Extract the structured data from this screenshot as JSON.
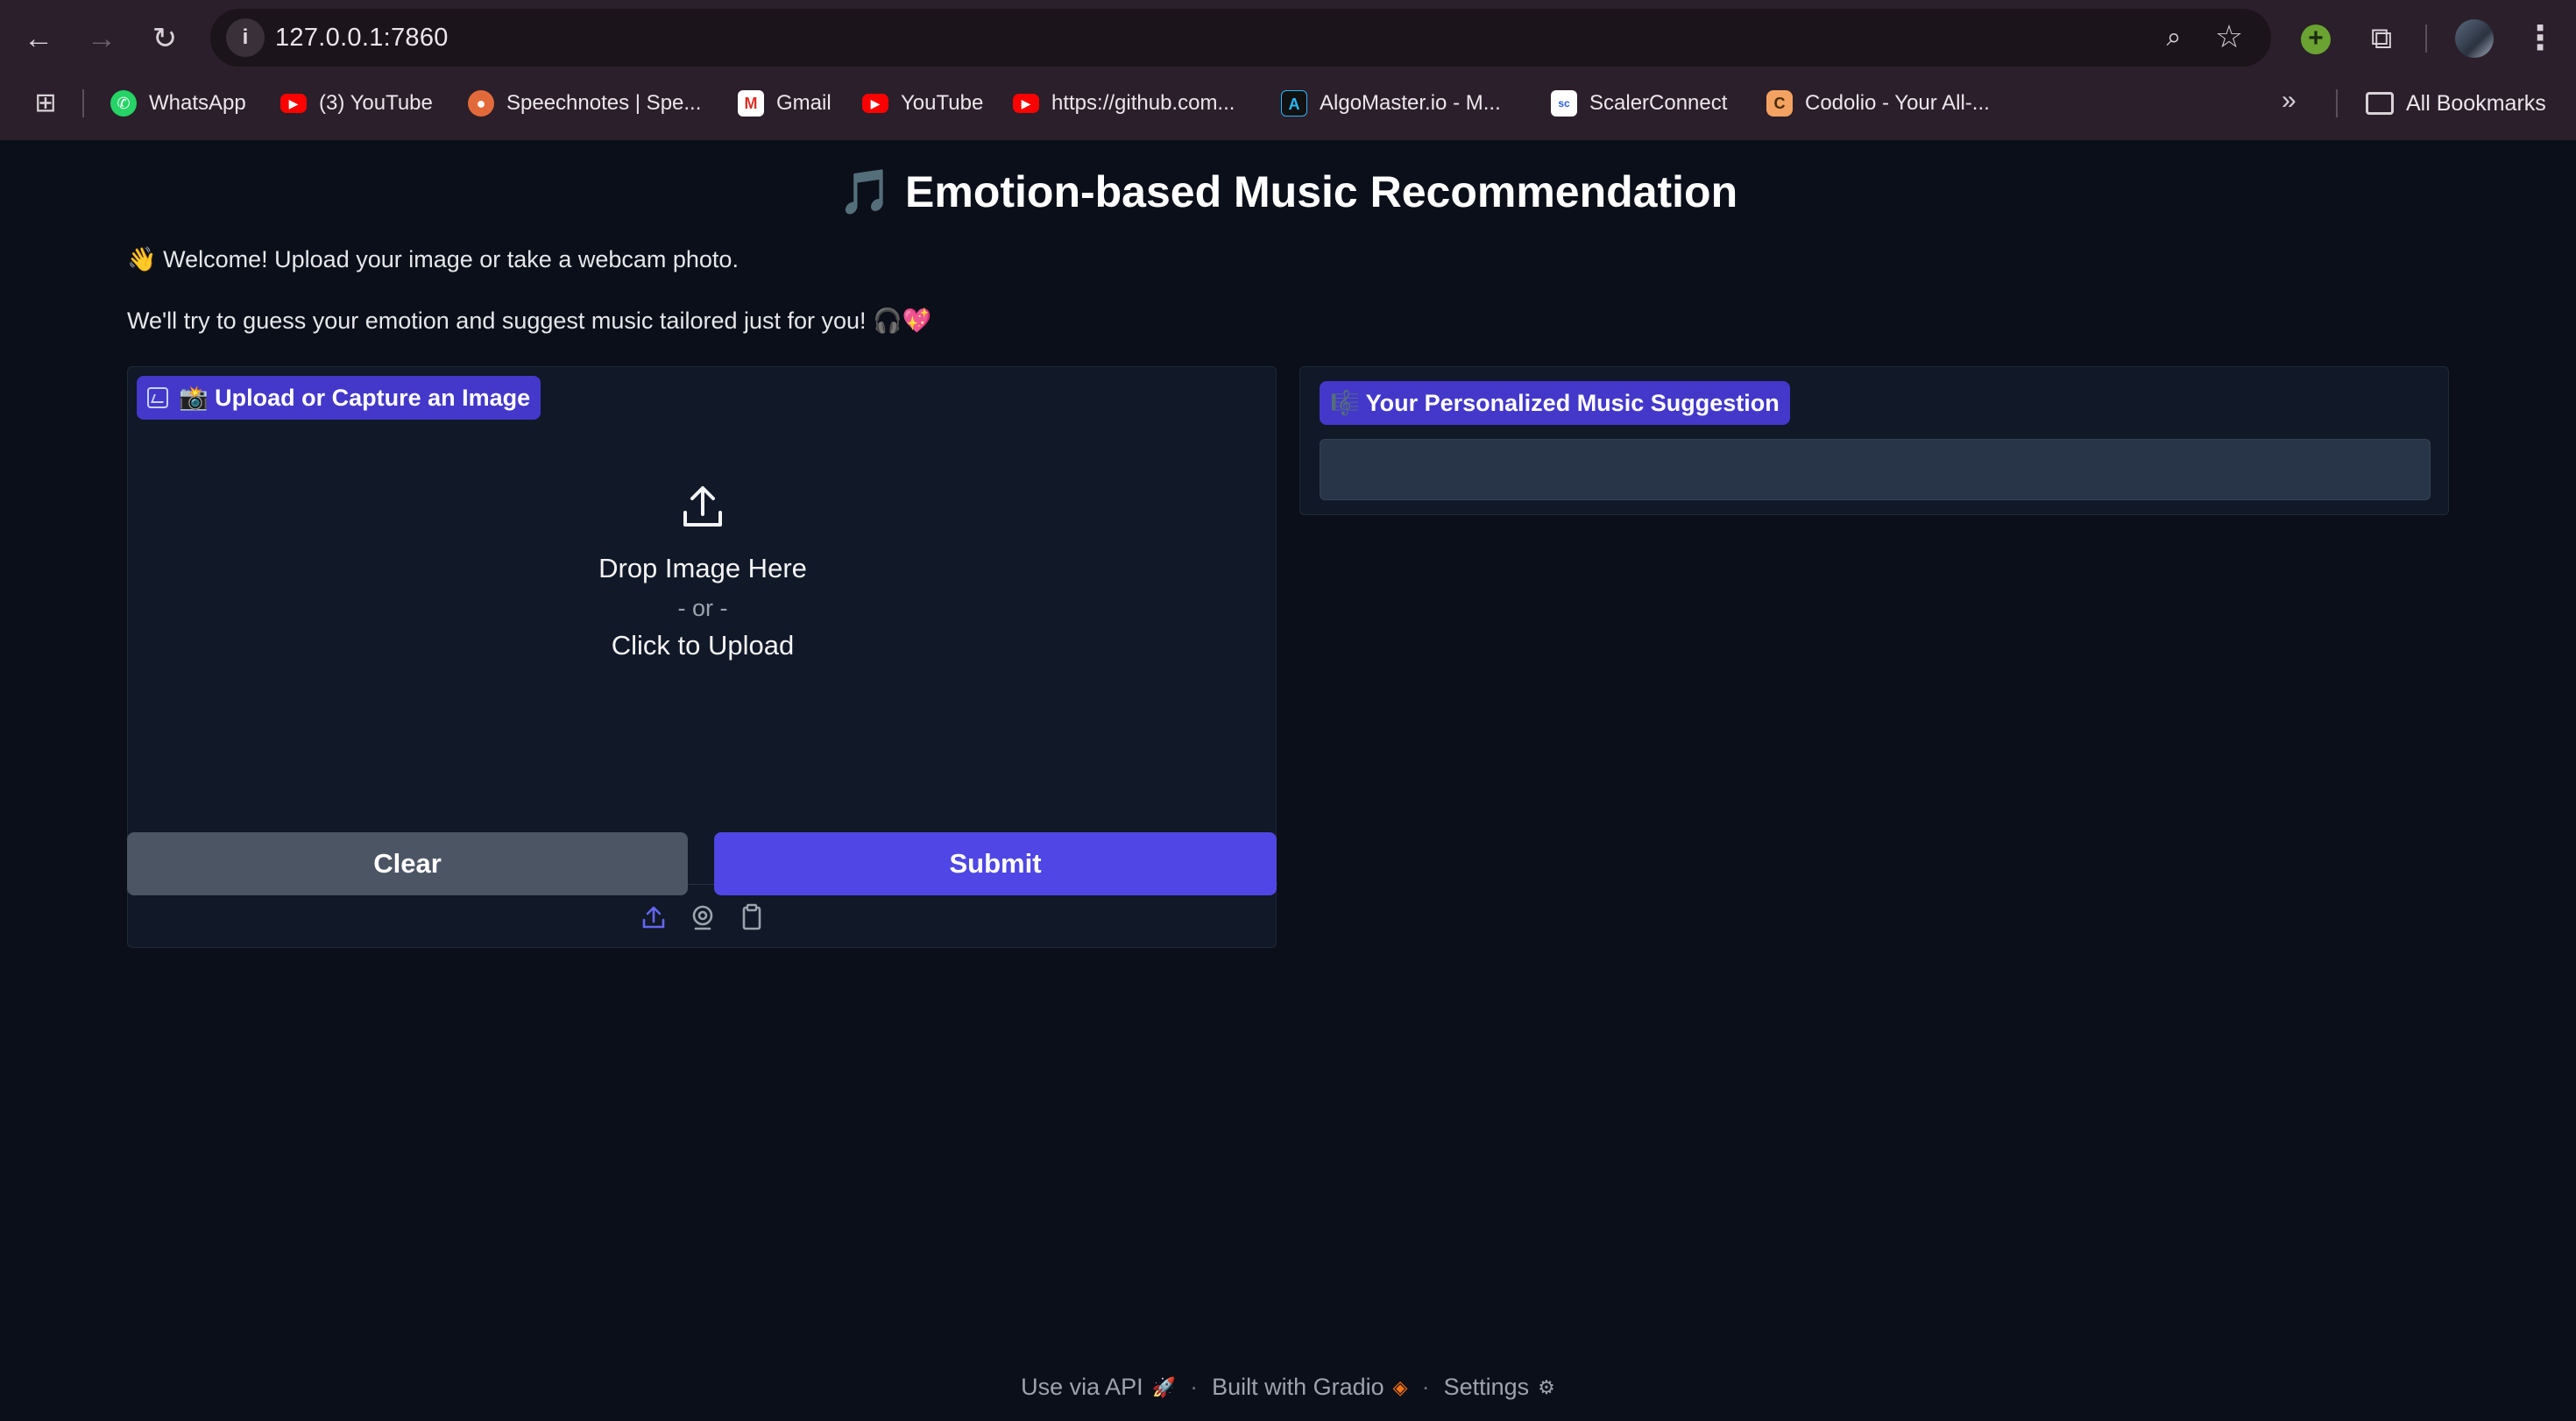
{
  "browser": {
    "url": "127.0.0.1:7860",
    "bookmarks": [
      {
        "label": "WhatsApp",
        "icon": "whatsapp-icon"
      },
      {
        "label": "(3) YouTube",
        "icon": "youtube-icon"
      },
      {
        "label": "Speechnotes | Spe...",
        "icon": "speechnotes-icon"
      },
      {
        "label": "Gmail",
        "icon": "gmail-icon"
      },
      {
        "label": "YouTube",
        "icon": "youtube-icon"
      },
      {
        "label": "https://github.com...",
        "icon": "youtube-icon"
      },
      {
        "label": "AlgoMaster.io - M...",
        "icon": "algomaster-icon"
      },
      {
        "label": "ScalerConnect",
        "icon": "scaler-icon"
      },
      {
        "label": "Codolio - Your All-...",
        "icon": "codolio-icon"
      }
    ],
    "all_bookmarks_label": "All Bookmarks"
  },
  "page": {
    "title": "🎵 Emotion-based Music Recommendation",
    "intro_line1": "👋 Welcome! Upload your image or take a webcam photo.",
    "intro_line2": "We'll try to guess your emotion and suggest music tailored just for you! 🎧💖"
  },
  "input_panel": {
    "label": "📸 Upload or Capture an Image",
    "drop_text": "Drop Image Here",
    "or_text": "- or -",
    "click_text": "Click to Upload",
    "sources": [
      "upload-icon",
      "webcam-icon",
      "clipboard-icon"
    ]
  },
  "buttons": {
    "clear": "Clear",
    "submit": "Submit"
  },
  "output_panel": {
    "label": "🎼 Your Personalized Music Suggestion",
    "value": ""
  },
  "footer": {
    "api": "Use via API",
    "built": "Built with Gradio",
    "settings": "Settings"
  },
  "colors": {
    "accent": "#4f46e5",
    "badge": "#4338ca",
    "background": "#0b0f19",
    "panel": "#111827",
    "clear_button": "#4b5563"
  }
}
